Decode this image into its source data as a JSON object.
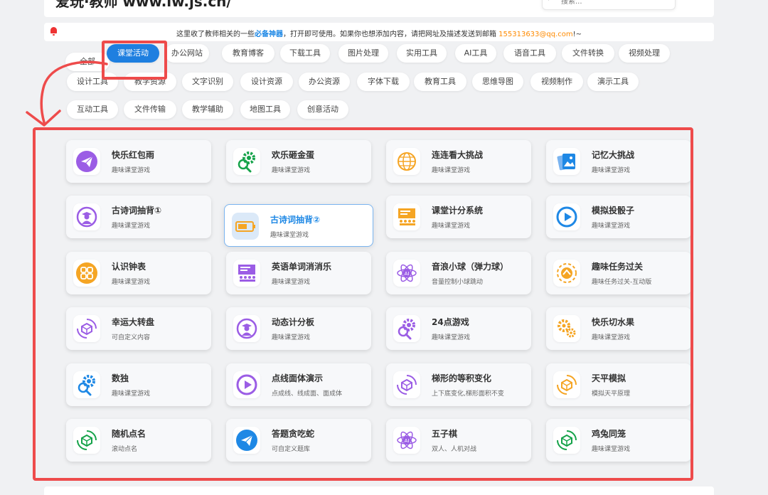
{
  "header": {
    "site_title": "爱玩·教师 www.iw.js.cn/",
    "search_placeholder": "搜索..."
  },
  "notice": {
    "prefix": "这里收了教师相关的一些",
    "highlight": "必备神器",
    "middle": "，打开即可使用。如果你也想添加内容，请把网址及描述发送到邮箱 ",
    "email": "155313633@qq.com",
    "suffix": "!~"
  },
  "tags": [
    "全部",
    "课堂活动",
    "办公网站",
    "教育博客",
    "下载工具",
    "图片处理",
    "实用工具",
    "AI工具",
    "语音工具",
    "文件转换",
    "视频处理",
    "设计工具",
    "教学资源",
    "文字识别",
    "设计资源",
    "办公资源",
    "字体下载",
    "教育工具",
    "思维导图",
    "视频制作",
    "演示工具",
    "互动工具",
    "文件传输",
    "教学辅助",
    "地图工具",
    "创意活动"
  ],
  "active_tag": "课堂活动",
  "cards": [
    {
      "title": "快乐红包雨",
      "sub": "趣味课堂游戏",
      "icon": "paper-plane-icon",
      "color": "#9b5de5"
    },
    {
      "title": "欢乐砸金蛋",
      "sub": "趣味课堂游戏",
      "icon": "gears-search-icon",
      "color": "#16a34a"
    },
    {
      "title": "连连看大挑战",
      "sub": "趣味课堂游戏",
      "icon": "globe-icon",
      "color": "#f5a524"
    },
    {
      "title": "记忆大挑战",
      "sub": "趣味课堂游戏",
      "icon": "photos-icon",
      "color": "#1e88e5"
    },
    {
      "title": "古诗词抽背①",
      "sub": "趣味课堂游戏",
      "icon": "student-icon",
      "color": "#9b5de5"
    },
    {
      "title": "古诗词抽背②",
      "sub": "趣味课堂游戏",
      "icon": "battery-icon",
      "color": "#f5a524"
    },
    {
      "title": "课堂计分系统",
      "sub": "趣味课堂游戏",
      "icon": "classroom-icon",
      "color": "#f5a524"
    },
    {
      "title": "模拟投骰子",
      "sub": "趣味课堂游戏",
      "icon": "play-icon",
      "color": "#1e88e5"
    },
    {
      "title": "认识钟表",
      "sub": "趣味课堂游戏",
      "icon": "grid-icon",
      "color": "#f5a524"
    },
    {
      "title": "英语单词消消乐",
      "sub": "趣味课堂游戏",
      "icon": "classroom-icon",
      "color": "#9b5de5"
    },
    {
      "title": "音浪小球（弹力球）",
      "sub": "音量控制小球跳动",
      "icon": "ai-atom-icon",
      "color": "#9b5de5"
    },
    {
      "title": "趣味任务过关",
      "sub": "趣味任务过关-互动版",
      "icon": "target-icon",
      "color": "#f5a524"
    },
    {
      "title": "幸运大转盘",
      "sub": "可自定义内容",
      "icon": "cube-cycle-icon",
      "color": "#9b5de5"
    },
    {
      "title": "动态计分板",
      "sub": "趣味课堂游戏",
      "icon": "student-icon",
      "color": "#9b5de5"
    },
    {
      "title": "24点游戏",
      "sub": "趣味课堂游戏",
      "icon": "gears-search-icon",
      "color": "#9b5de5"
    },
    {
      "title": "快乐切水果",
      "sub": "趣味课堂游戏",
      "icon": "gears-icon",
      "color": "#f5a524"
    },
    {
      "title": "数独",
      "sub": "趣味课堂游戏",
      "icon": "gears-search-icon",
      "color": "#1e88e5"
    },
    {
      "title": "点线面体演示",
      "sub": "点成线、线成面、面成体",
      "icon": "play-icon",
      "color": "#9b5de5"
    },
    {
      "title": "梯形的等积变化",
      "sub": "上下底变化,梯形面积不变",
      "icon": "cube-cycle-icon",
      "color": "#9b5de5"
    },
    {
      "title": "天平模拟",
      "sub": "模拟天平原理",
      "icon": "cube-cycle-icon",
      "color": "#f5a524"
    },
    {
      "title": "随机点名",
      "sub": "滚动点名",
      "icon": "cube-cycle-icon",
      "color": "#16a34a"
    },
    {
      "title": "答题贪吃蛇",
      "sub": "可自定义题库",
      "icon": "paper-plane-icon",
      "color": "#1e88e5"
    },
    {
      "title": "五子棋",
      "sub": "双人、人机对战",
      "icon": "ai-atom-icon",
      "color": "#9b5de5"
    },
    {
      "title": "鸡兔同笼",
      "sub": "趣味课堂游戏",
      "icon": "cube-cycle-icon",
      "color": "#16a34a"
    }
  ]
}
